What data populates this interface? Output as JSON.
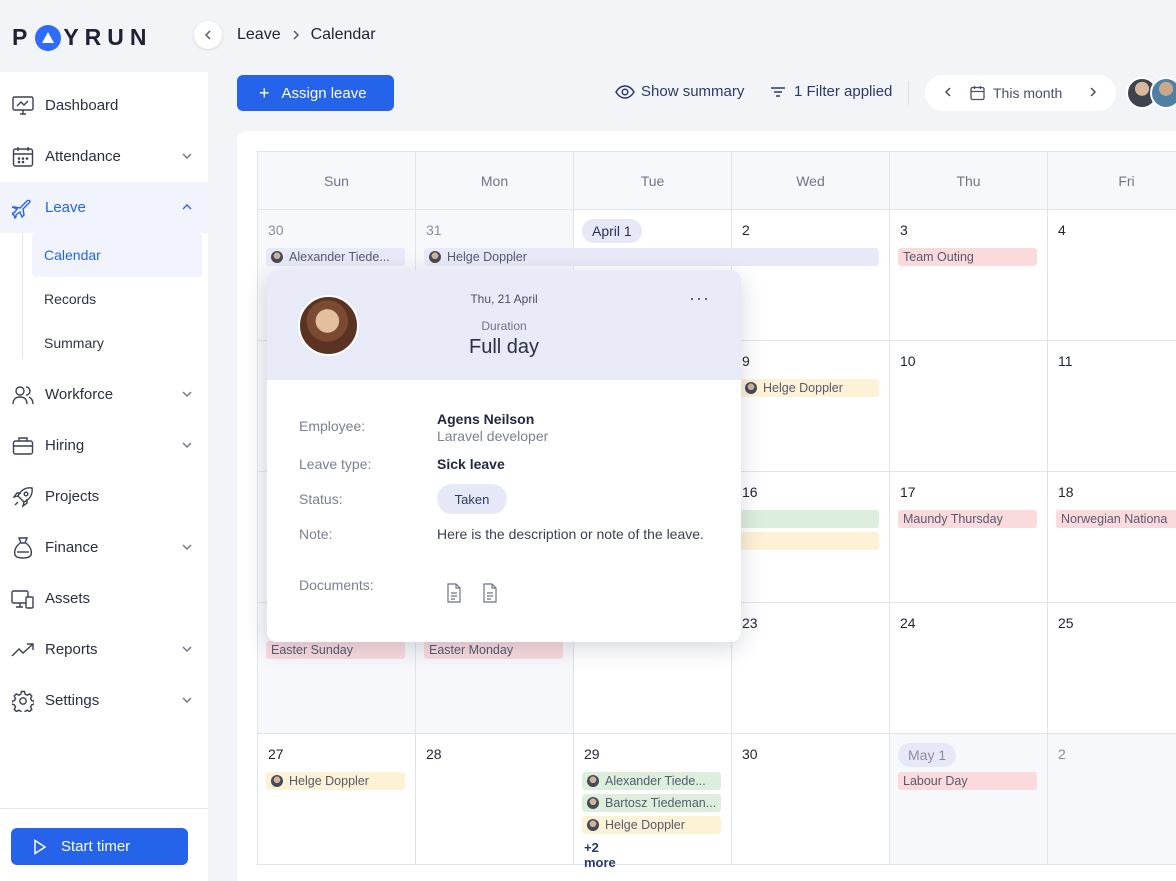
{
  "brand": {
    "logo_text_before": "P",
    "logo_text_after": "YRUN",
    "accent": "#2563eb"
  },
  "sidebar": {
    "items": [
      {
        "label": "Dashboard",
        "icon": "monitor-icon",
        "has_chevron": false,
        "active": false
      },
      {
        "label": "Attendance",
        "icon": "calendar-grid-icon",
        "has_chevron": true,
        "active": false
      },
      {
        "label": "Leave",
        "icon": "plane-icon",
        "has_chevron": true,
        "active": true
      },
      {
        "label": "Workforce",
        "icon": "users-icon",
        "has_chevron": true,
        "active": false
      },
      {
        "label": "Hiring",
        "icon": "briefcase-icon",
        "has_chevron": true,
        "active": false
      },
      {
        "label": "Projects",
        "icon": "rocket-icon",
        "has_chevron": false,
        "active": false
      },
      {
        "label": "Finance",
        "icon": "money-bag-icon",
        "has_chevron": true,
        "active": false
      },
      {
        "label": "Assets",
        "icon": "devices-icon",
        "has_chevron": false,
        "active": false
      },
      {
        "label": "Reports",
        "icon": "trend-icon",
        "has_chevron": true,
        "active": false
      },
      {
        "label": "Settings",
        "icon": "gear-icon",
        "has_chevron": true,
        "active": false
      }
    ],
    "leave_subitems": [
      "Calendar",
      "Records",
      "Summary"
    ],
    "start_timer_label": "Start timer"
  },
  "header": {
    "breadcrumb": [
      "Leave",
      "Calendar"
    ],
    "assign_label": "Assign leave",
    "show_summary_label": "Show summary",
    "filter_label": "1 Filter applied",
    "period_label": "This month"
  },
  "calendar": {
    "weekdays": [
      "Sun",
      "Mon",
      "Tue",
      "Wed",
      "Thu",
      "Fri"
    ],
    "weeks": [
      [
        "30",
        "31",
        "April 1",
        "2",
        "3",
        "4"
      ],
      [
        "",
        "",
        "",
        "9",
        "10",
        "11"
      ],
      [
        "",
        "",
        "",
        "16",
        "17",
        "18"
      ],
      [
        "",
        "",
        "",
        "23",
        "24",
        "25"
      ],
      [
        "27",
        "28",
        "29",
        "30",
        "May 1",
        "2"
      ]
    ],
    "events": {
      "alexander": "Alexander Tiede...",
      "helge": "Helge Doppler",
      "team_outing": "Team Outing",
      "maundy": "Maundy Thursday",
      "norwegian": "Norwegian Nationa",
      "easter_sunday": "Easter Sunday",
      "easter_monday": "Easter Monday",
      "labour_day": "Labour Day",
      "alexander_2": "Alexander Tiede...",
      "bartosz": "Bartosz Tiedeman...",
      "more": "+2 more"
    }
  },
  "popup": {
    "date": "Thu, 21 April",
    "duration_label": "Duration",
    "duration_value": "Full day",
    "employee_label": "Employee:",
    "employee_name": "Agens Neilson",
    "employee_role": "Laravel developer",
    "leave_type_label": "Leave type:",
    "leave_type": "Sick leave",
    "status_label": "Status:",
    "status": "Taken",
    "note_label": "Note:",
    "note": "Here is the description or note of the leave.",
    "documents_label": "Documents:"
  }
}
